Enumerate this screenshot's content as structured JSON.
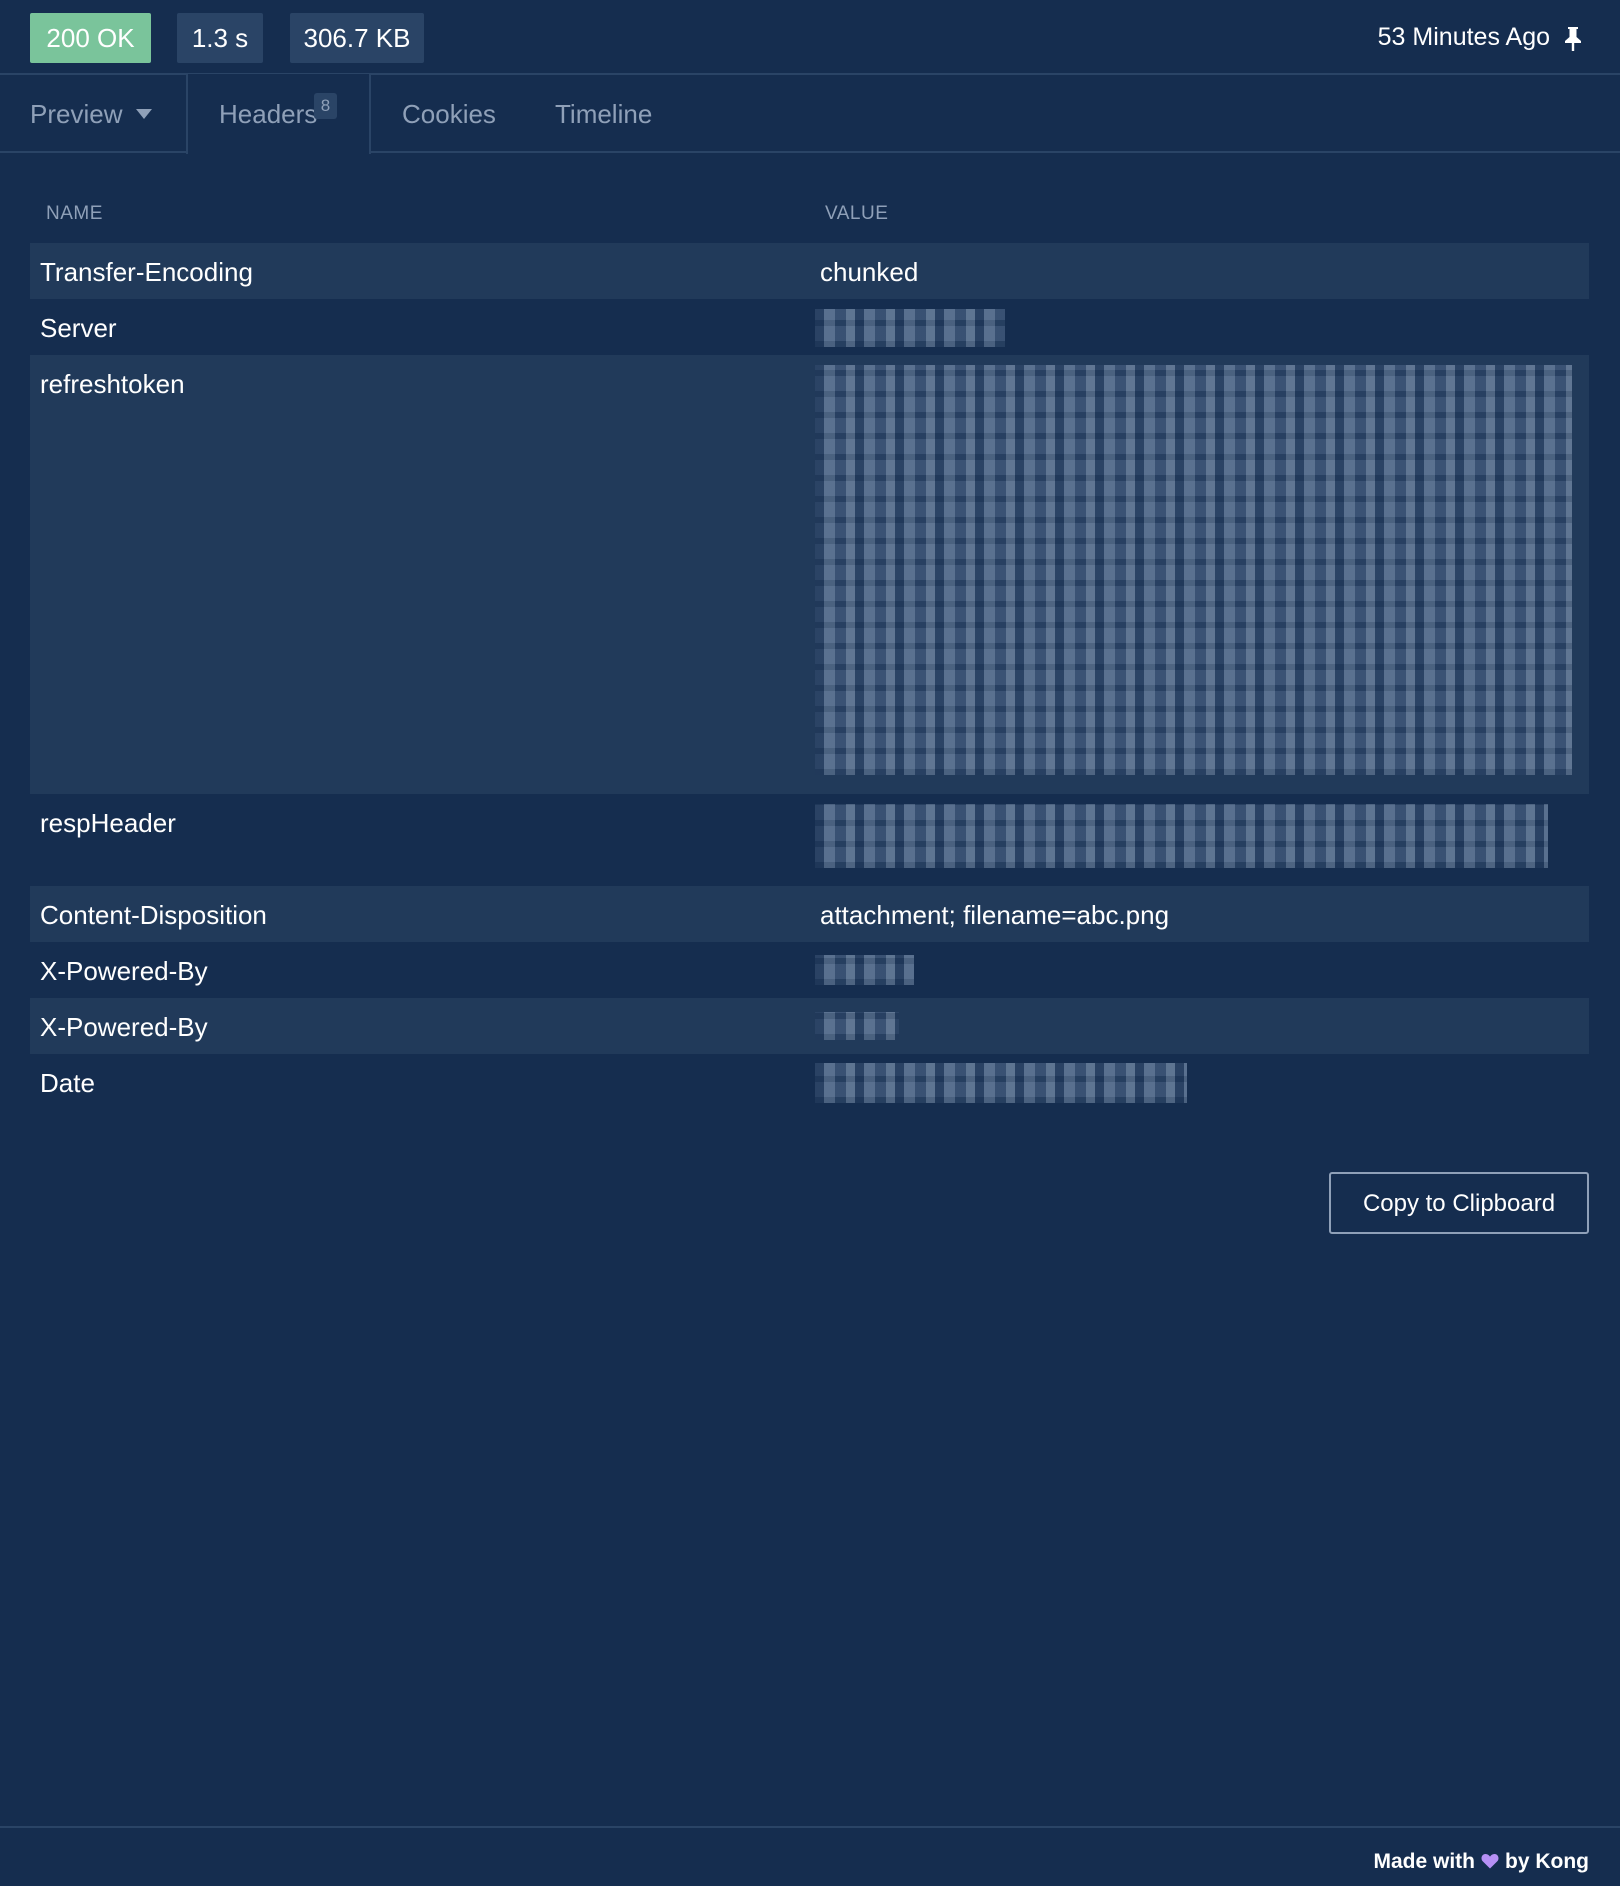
{
  "status": {
    "code_label": "200 OK",
    "time_label": "1.3 s",
    "size_label": "306.7 KB",
    "timestamp_label": "53 Minutes Ago",
    "status_color": "#7ac49b"
  },
  "tabs": {
    "preview": "Preview",
    "headers": "Headers",
    "headers_count": "8",
    "cookies": "Cookies",
    "timeline": "Timeline",
    "active": "Headers"
  },
  "table": {
    "columns": [
      "NAME",
      "VALUE"
    ],
    "rows": [
      {
        "name": "Transfer-Encoding",
        "value": "chunked"
      },
      {
        "name": "Server",
        "value": ""
      },
      {
        "name": "refreshtoken",
        "value": ""
      },
      {
        "name": "respHeader",
        "value": ""
      },
      {
        "name": "Content-Disposition",
        "value": "attachment; filename=abc.png"
      },
      {
        "name": "X-Powered-By",
        "value": ""
      },
      {
        "name": "X-Powered-By",
        "value": ""
      },
      {
        "name": "Date",
        "value": ""
      }
    ]
  },
  "actions": {
    "copy_label": "Copy to Clipboard"
  },
  "footer": {
    "made_with": "Made with",
    "by_kong": "by Kong",
    "heart_color": "#b690f5"
  }
}
